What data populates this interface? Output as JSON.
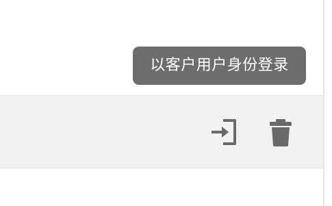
{
  "tooltip": {
    "text": "以客户用户身份登录"
  },
  "row_actions": {
    "login_as_icon": "login-arrow-icon",
    "delete_icon": "trash-icon"
  },
  "colors": {
    "tooltip_bg": "#6d6d6d",
    "icon_color": "#6a6a6a",
    "highlight_row_bg": "#f2f2f2"
  }
}
